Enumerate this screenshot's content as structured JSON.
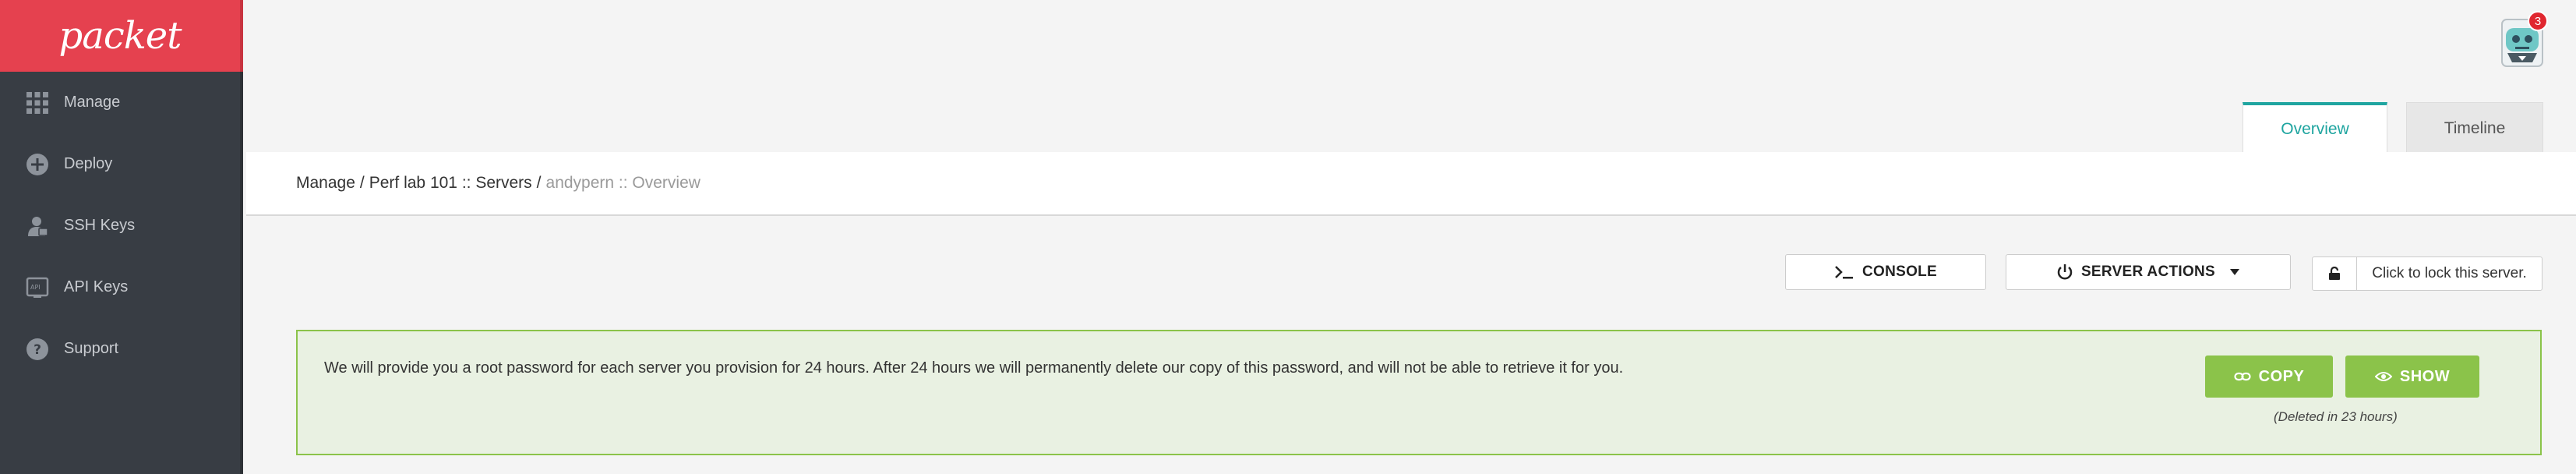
{
  "app": {
    "logo_text": "packet",
    "brand_color": "#e5414f",
    "accent_color": "#1fa5a0",
    "success_color": "#8bc34a"
  },
  "sidebar": {
    "items": [
      {
        "label": "Manage",
        "icon": "grid-icon"
      },
      {
        "label": "Deploy",
        "icon": "plus-circle-icon"
      },
      {
        "label": "SSH Keys",
        "icon": "key-user-icon"
      },
      {
        "label": "API Keys",
        "icon": "api-icon"
      },
      {
        "label": "Support",
        "icon": "help-icon"
      }
    ]
  },
  "header": {
    "notification_count": "3",
    "tabs": [
      {
        "label": "Overview",
        "active": true
      },
      {
        "label": "Timeline",
        "active": false
      }
    ]
  },
  "breadcrumb": {
    "manage": "Manage",
    "project": "Perf lab 101 :: Servers",
    "current": "andypern :: Overview",
    "separator": "/"
  },
  "toolbar": {
    "console_label": "CONSOLE",
    "server_actions_label": "SERVER ACTIONS",
    "lock_label": "Click to lock this server."
  },
  "password_notice": {
    "message": "We will provide you a root password for each server you provision for 24 hours. After 24 hours we will permanently delete our copy of this password, and will not be able to retrieve it for you.",
    "copy_label": "COPY",
    "show_label": "SHOW",
    "deleted_note": "(Deleted in 23 hours)"
  }
}
